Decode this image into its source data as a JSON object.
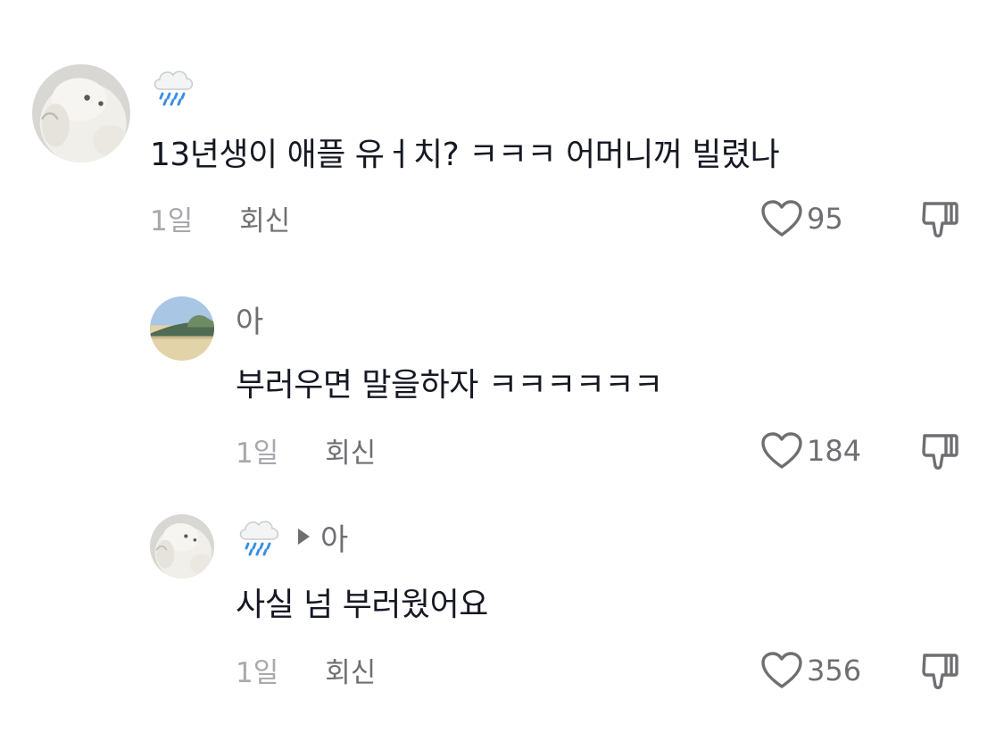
{
  "comments": [
    {
      "username": "",
      "user_icon": "rain-cloud-icon",
      "avatar": "plush-bear-avatar",
      "text": "13년생이 애플 유ㅓ치? ㅋㅋㅋ 어머니꺼 빌렸나",
      "time": "1일",
      "reply_label": "회신",
      "likes": "95"
    },
    {
      "username": "아",
      "avatar": "landscape-avatar",
      "text": "부러우면 말을하자 ㅋㅋㅋㅋㅋㅋ",
      "time": "1일",
      "reply_label": "회신",
      "likes": "184"
    },
    {
      "username": "",
      "user_icon": "rain-cloud-icon",
      "reply_to": "아",
      "avatar": "plush-bear-avatar",
      "text": "사실 넘 부러웠어요",
      "time": "1일",
      "reply_label": "회신",
      "likes": "356"
    }
  ],
  "colors": {
    "primary_text": "#161823",
    "secondary_text": "#6f6f73",
    "muted_text": "#a8a8ad"
  }
}
